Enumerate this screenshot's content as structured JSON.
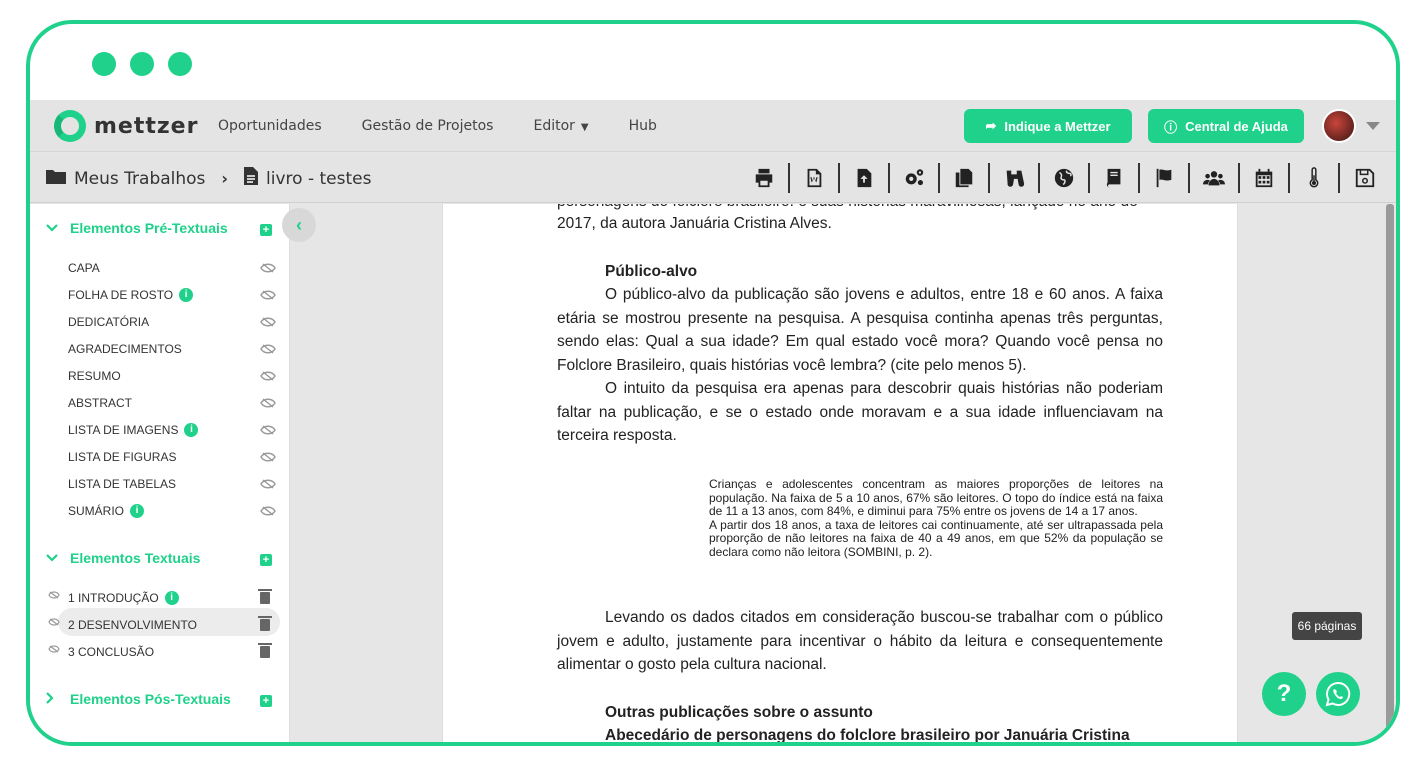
{
  "brand": {
    "name": "mettzer",
    "accent": "#1fd18a"
  },
  "nav": {
    "items": [
      {
        "label": "Oportunidades"
      },
      {
        "label": "Gestão de Projetos"
      },
      {
        "label": "Editor",
        "has_dropdown": true
      },
      {
        "label": "Hub"
      }
    ],
    "indique_button": "Indique a Mettzer",
    "ajuda_button": "Central de Ajuda"
  },
  "breadcrumb": {
    "root": "Meus Trabalhos",
    "current": "livro - testes"
  },
  "toolbar": {
    "tools": [
      "print-icon",
      "word-export-icon",
      "file-upload-icon",
      "settings-icon",
      "copy-icon",
      "binoculars-icon",
      "globe-icon",
      "book-icon",
      "flag-icon",
      "users-icon",
      "calendar-icon",
      "thermometer-icon",
      "save-icon"
    ]
  },
  "sidebar": {
    "pre": {
      "title": "Elementos Pré-Textuais",
      "items": [
        {
          "label": "CAPA",
          "info": false
        },
        {
          "label": "FOLHA DE ROSTO",
          "info": true
        },
        {
          "label": "DEDICATÓRIA",
          "info": false
        },
        {
          "label": "AGRADECIMENTOS",
          "info": false
        },
        {
          "label": "RESUMO",
          "info": false
        },
        {
          "label": "ABSTRACT",
          "info": false
        },
        {
          "label": "LISTA DE IMAGENS",
          "info": true
        },
        {
          "label": "LISTA DE FIGURAS",
          "info": false
        },
        {
          "label": "LISTA DE TABELAS",
          "info": false
        },
        {
          "label": "SUMÁRIO",
          "info": true
        }
      ]
    },
    "textual": {
      "title": "Elementos Textuais",
      "items": [
        {
          "label": "1 INTRODUÇÃO",
          "info": true
        },
        {
          "label": "2 DESENVOLVIMENTO",
          "info": false
        },
        {
          "label": "3 CONCLUSÃO",
          "info": false
        }
      ]
    },
    "pos": {
      "title": "Elementos Pós-Textuais"
    }
  },
  "document": {
    "top_cut": "personagens do folclore brasileiro: e suas histórias maravilhosas, lançado no ano de",
    "top_line": "2017, da autora Januária Cristina Alves.",
    "h1": "Público-alvo",
    "p1": "O público-alvo da publicação são jovens e adultos, entre 18 e 60 anos. A faixa etária se mostrou presente na pesquisa. A pesquisa continha apenas três perguntas, sendo elas: Qual a sua idade? Em qual estado você mora? Quando você pensa no Folclore Brasileiro, quais histórias você lembra? (cite pelo menos 5).",
    "p2": "O intuito da pesquisa era apenas para descobrir quais histórias não poderiam faltar na publicação, e se o estado onde moravam e a sua idade influenciavam na terceira resposta.",
    "quote1": "Crianças e adolescentes concentram as maiores proporções de leitores na população. Na faixa de 5 a 10 anos, 67% são leitores. O topo do índice está na faixa de 11 a 13 anos, com 84%, e diminui para 75% entre os jovens de 14 a 17 anos.",
    "quote2": "A partir dos 18 anos, a taxa de leitores cai continuamente, até ser ultrapassada pela proporção de não leitores na faixa de 40 a 49 anos, em que 52% da população se declara como não leitora (SOMBINI, p. 2).",
    "p3": "Levando os dados citados em consideração buscou-se trabalhar com o público jovem e adulto, justamente para incentivar o hábito da leitura e consequentemente alimentar o gosto pela cultura nacional.",
    "h2": "Outras publicações sobre o assunto",
    "h3": "Abecedário de personagens do folclore brasileiro por Januária Cristina"
  },
  "pages_badge": "66 páginas"
}
